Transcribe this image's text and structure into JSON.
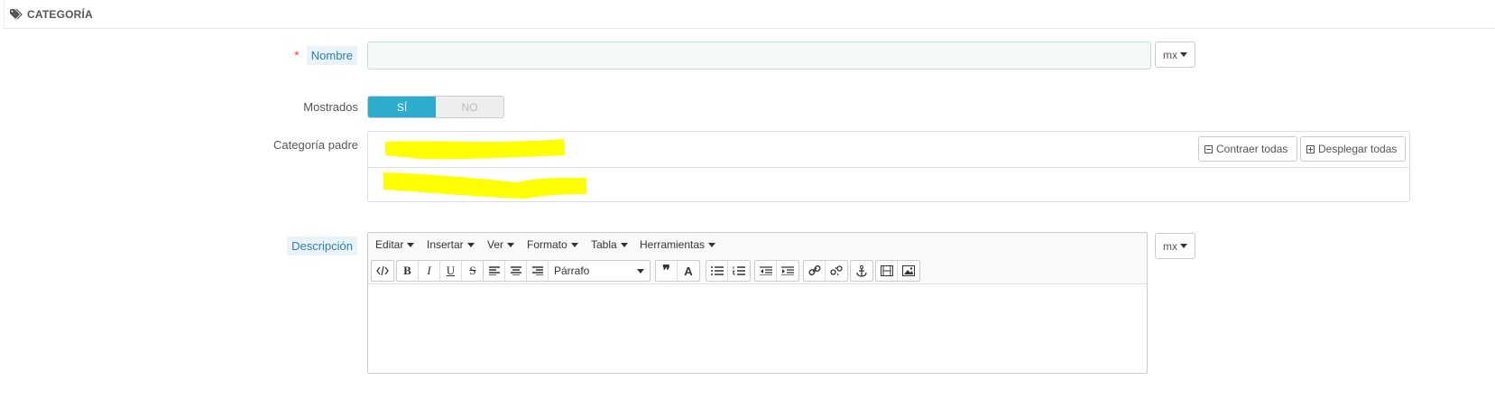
{
  "panel": {
    "title": "CATEGORÍA",
    "icon": "tags-icon"
  },
  "fields": {
    "name": {
      "required_mark": "*",
      "label": "Nombre",
      "value": "",
      "placeholder": "",
      "lang": "mx"
    },
    "displayed": {
      "label": "Mostrados",
      "on_label": "SÍ",
      "off_label": "NO",
      "selected": "SÍ"
    },
    "parent": {
      "label": "Categoría padre",
      "collapse_label": "Contraer todas",
      "expand_label": "Desplegar todas"
    },
    "description": {
      "label": "Descripción",
      "lang": "mx"
    }
  },
  "editor": {
    "menus": [
      "Editar",
      "Insertar",
      "Ver",
      "Formato",
      "Tabla",
      "Herramientas"
    ],
    "format_select": "Párrafo"
  },
  "colors": {
    "accent": "#2eacce",
    "hint_bg": "#e9f3f9",
    "hint_text": "#2e7da8",
    "required": "#e74c3c",
    "redaction": "#ffff00"
  }
}
